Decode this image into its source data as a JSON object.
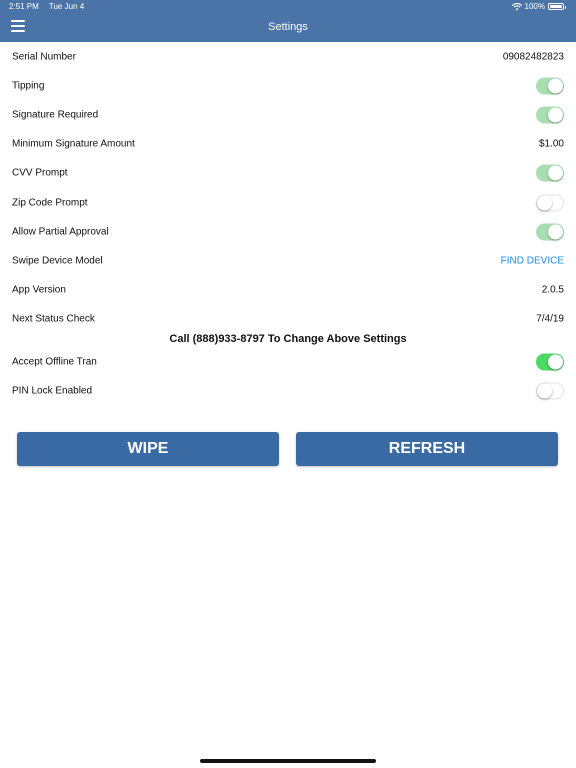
{
  "status_bar": {
    "time": "2:51 PM",
    "date": "Tue Jun 4",
    "battery": "100%"
  },
  "header": {
    "title": "Settings"
  },
  "settings": [
    {
      "label": "Serial Number",
      "type": "value",
      "value": "09082482823"
    },
    {
      "label": "Tipping",
      "type": "toggle",
      "on": true
    },
    {
      "label": "Signature Required",
      "type": "toggle",
      "on": true
    },
    {
      "label": "Minimum Signature Amount",
      "type": "value",
      "value": "$1.00"
    },
    {
      "label": "CVV Prompt",
      "type": "toggle",
      "on": true
    },
    {
      "label": "Zip Code Prompt",
      "type": "toggle",
      "on": false
    },
    {
      "label": "Allow Partial Approval",
      "type": "toggle",
      "on": true
    },
    {
      "label": "Swipe Device Model",
      "type": "link",
      "value": "FIND DEVICE"
    },
    {
      "label": "App Version",
      "type": "value",
      "value": "2.0.5"
    },
    {
      "label": "Next Status Check",
      "type": "value",
      "value": "7/4/19"
    }
  ],
  "notice": "Call (888)933-8797 To Change Above Settings",
  "local_settings": [
    {
      "label": "Accept Offline Tran",
      "type": "toggle",
      "on": true
    },
    {
      "label": "PIN Lock Enabled",
      "type": "toggle",
      "on": false
    }
  ],
  "buttons": {
    "wipe": "WIPE",
    "refresh": "REFRESH"
  },
  "colors": {
    "header": "#4a73a8",
    "button": "#3a6aa3",
    "toggle_on_muted": "#a8deb2",
    "toggle_on": "#4cd964",
    "link": "#1e8be0"
  }
}
